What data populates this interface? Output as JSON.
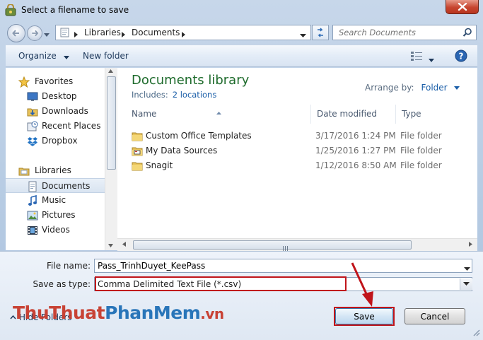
{
  "window": {
    "title": "Select a filename to save"
  },
  "address_bar": {
    "crumbs": [
      "Libraries",
      "Documents"
    ]
  },
  "search": {
    "placeholder": "Search Documents"
  },
  "toolbar": {
    "organize_label": "Organize",
    "new_folder_label": "New folder"
  },
  "nav": {
    "favorites_header": "Favorites",
    "favorites": [
      {
        "label": "Desktop",
        "icon": "desktop-icon"
      },
      {
        "label": "Downloads",
        "icon": "downloads-icon"
      },
      {
        "label": "Recent Places",
        "icon": "recent-places-icon"
      },
      {
        "label": "Dropbox",
        "icon": "dropbox-icon"
      }
    ],
    "libraries_header": "Libraries",
    "libraries": [
      {
        "label": "Documents",
        "icon": "documents-icon",
        "selected": true
      },
      {
        "label": "Music",
        "icon": "music-icon"
      },
      {
        "label": "Pictures",
        "icon": "pictures-icon"
      },
      {
        "label": "Videos",
        "icon": "videos-icon"
      }
    ]
  },
  "library": {
    "title": "Documents library",
    "includes_label": "Includes:",
    "includes_link": "2 locations",
    "arrange_label": "Arrange by:",
    "arrange_value": "Folder"
  },
  "columns": {
    "name": "Name",
    "date": "Date modified",
    "type": "Type"
  },
  "files": [
    {
      "name": "Custom Office Templates",
      "date": "3/17/2016 1:24 PM",
      "type": "File folder",
      "icon": "folder-icon"
    },
    {
      "name": "My Data Sources",
      "date": "1/25/2016 1:27 PM",
      "type": "File folder",
      "icon": "data-sources-folder-icon"
    },
    {
      "name": "Snagit",
      "date": "1/12/2016 8:50 AM",
      "type": "File folder",
      "icon": "folder-icon"
    }
  ],
  "form": {
    "file_name_label": "File name:",
    "file_name_value": "Pass_TrinhDuyet_KeePass",
    "save_type_label": "Save as type:",
    "save_type_value": "Comma Delimited Text File (*.csv)"
  },
  "footer": {
    "hide_folders_label": "Hide Folders",
    "save_label": "Save",
    "cancel_label": "Cancel"
  },
  "watermark": {
    "part1": "ThuThuat",
    "part2": "PhanMem",
    "part3": ".vn"
  },
  "colors": {
    "highlight": "#c0141a",
    "library_title": "#1e6b2c",
    "link": "#1a5ea8"
  }
}
